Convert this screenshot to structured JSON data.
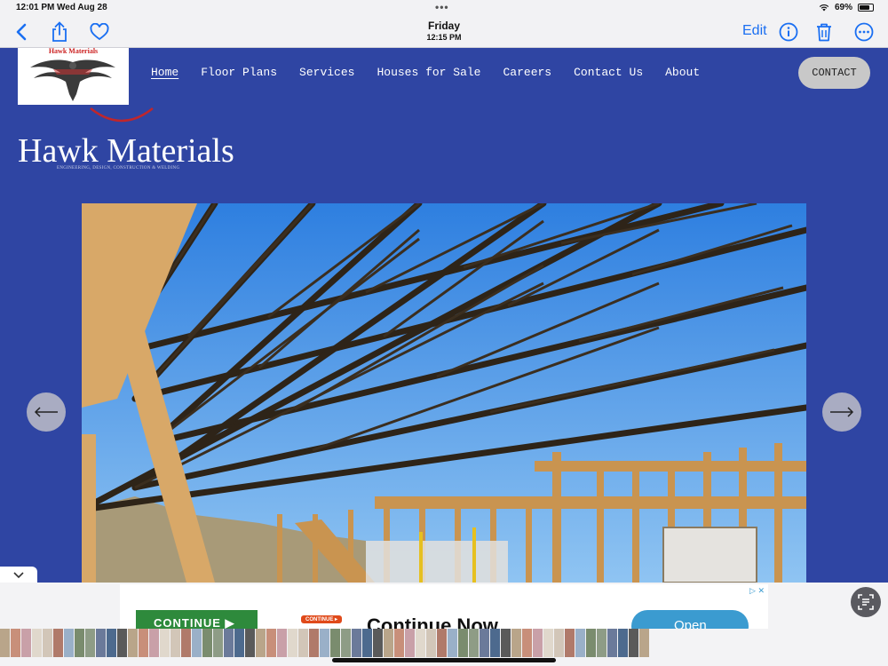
{
  "status_bar": {
    "time": "12:01 PM",
    "date": "Wed Aug 28",
    "battery": "69%"
  },
  "toolbar": {
    "title_day": "Friday",
    "title_time": "12:15 PM",
    "edit_label": "Edit"
  },
  "site": {
    "logo_text": "Hawk Materials",
    "brand_name": "Hawk Materials",
    "tagline": "ENGINEERING, DESIGN, CONSTRUCTION & WELDING",
    "nav": [
      {
        "label": "Home",
        "active": true
      },
      {
        "label": "Floor Plans"
      },
      {
        "label": "Services"
      },
      {
        "label": "Houses for Sale"
      },
      {
        "label": "Careers"
      },
      {
        "label": "Contact Us"
      },
      {
        "label": "About"
      }
    ],
    "contact_button": "CONTACT"
  },
  "ad": {
    "continue_button": "CONTINUE ▶",
    "badge": "CONTINUE ▸",
    "headline": "Continue Now",
    "open_button": "Open"
  },
  "colors": {
    "site_bg": "#2f45a3",
    "ios_blue": "#1a6ff2",
    "sky": "#3f8ae6"
  }
}
